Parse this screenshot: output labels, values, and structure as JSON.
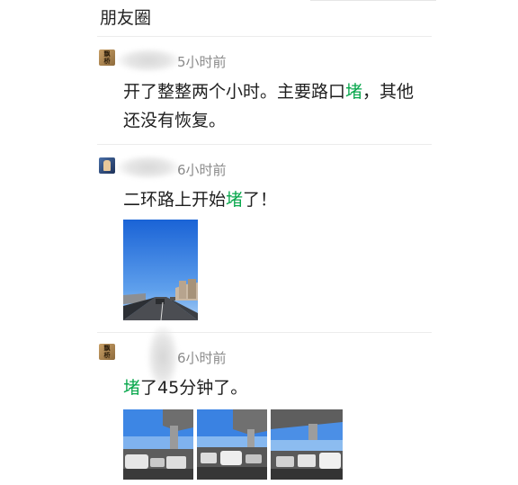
{
  "header": {
    "title": "朋友圈"
  },
  "posts": [
    {
      "time": "5小时前",
      "text_parts": [
        "开了整整两个小时。主要路口",
        "堵",
        "，其他还没有恢复。"
      ]
    },
    {
      "time": "6小时前",
      "text_parts": [
        "二环路上开始",
        "堵",
        "了！"
      ],
      "images": [
        "traffic-photo-1"
      ]
    },
    {
      "time": "6小时前",
      "text_parts": [
        "",
        "堵",
        "了45分钟了。"
      ],
      "images": [
        "traffic-photo-2",
        "traffic-photo-3",
        "traffic-photo-4"
      ]
    }
  ],
  "colors": {
    "highlight": "#08a74c",
    "time": "#8a8a8a",
    "sky": "#2f7de0"
  },
  "avatars": {
    "gold_text": "飘 桥"
  }
}
